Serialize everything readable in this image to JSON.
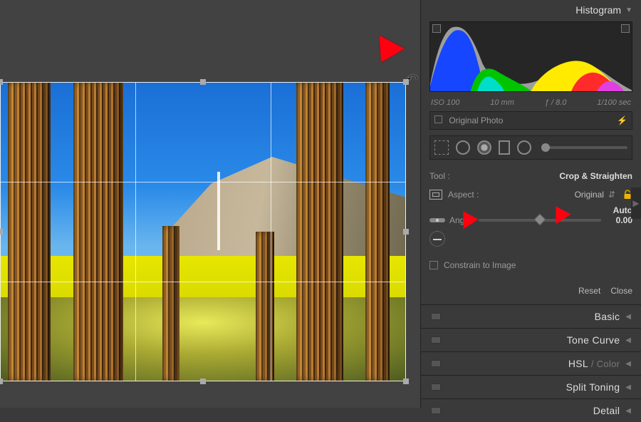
{
  "annotations": {
    "arrow_color": "#ff0010"
  },
  "canvas": {
    "rotate_cursor_glyph": "⤺"
  },
  "side": {
    "histogram": {
      "title": "Histogram",
      "meta": {
        "iso": "ISO 100",
        "focal": "10 mm",
        "fstop": "ƒ / 8.0",
        "shutter": "1/100 sec"
      },
      "original_label": "Original Photo",
      "flash_glyph": "⚡"
    },
    "toolstrip": {
      "slider_pos": 0
    },
    "crop": {
      "tool_label": "Tool :",
      "tool_name": "Crop & Straighten",
      "aspect_label": "Aspect :",
      "aspect_value": "Original",
      "aspect_arrows": "⇵",
      "angle_label": "Angle",
      "auto_label": "Auto",
      "angle_value": "0.00",
      "constrain_label": "Constrain to Image",
      "reset": "Reset",
      "close": "Close"
    },
    "sections": [
      {
        "name": "Basic",
        "sub": ""
      },
      {
        "name": "Tone Curve",
        "sub": ""
      },
      {
        "name": "HSL",
        "sub": " / Color"
      },
      {
        "name": "Split Toning",
        "sub": ""
      },
      {
        "name": "Detail",
        "sub": ""
      }
    ]
  }
}
